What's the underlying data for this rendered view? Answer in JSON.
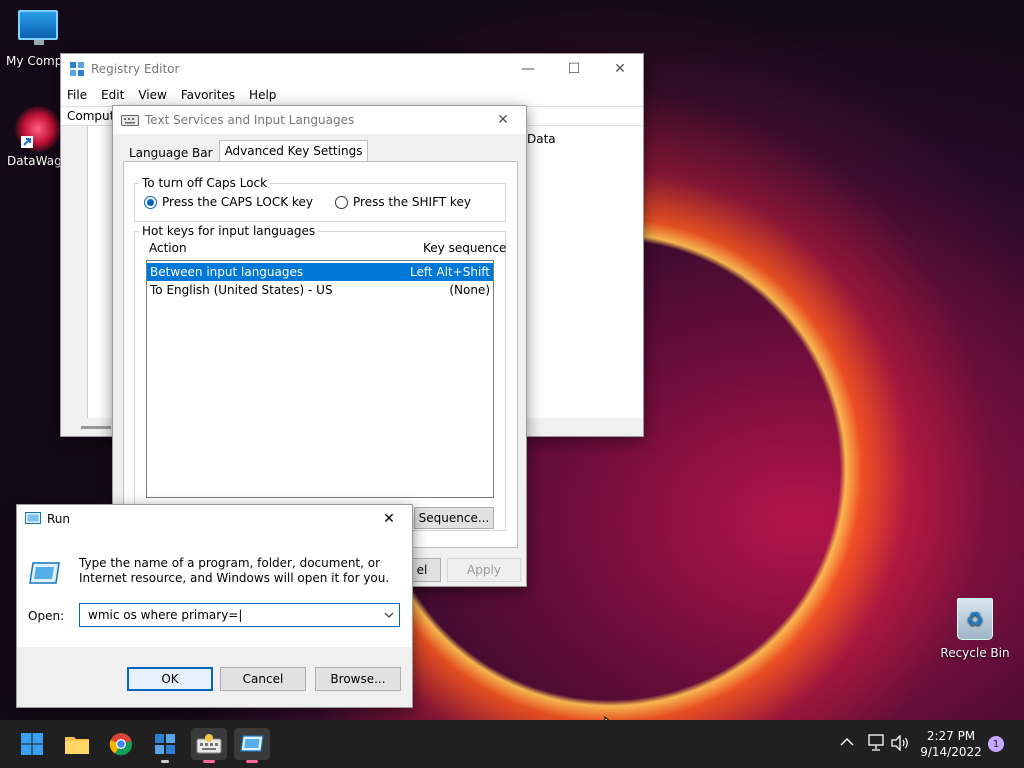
{
  "desktop": {
    "icons": [
      {
        "label": "My Compu"
      },
      {
        "label": "DataWago"
      },
      {
        "label": "Recycle Bin"
      }
    ]
  },
  "registry": {
    "title": "Registry Editor",
    "menu": [
      "File",
      "Edit",
      "View",
      "Favorites",
      "Help"
    ],
    "address": "Comput",
    "column_data": "Data"
  },
  "tsil": {
    "title": "Text Services and Input Languages",
    "tabs": [
      "Language Bar",
      "Advanced Key Settings"
    ],
    "caps_group": "To turn off Caps Lock",
    "radio_caps": "Press the CAPS LOCK key",
    "radio_shift": "Press the SHIFT key",
    "hotkeys_group": "Hot keys for input languages",
    "col_action": "Action",
    "col_keyseq": "Key sequence",
    "rows": [
      {
        "action": "Between input languages",
        "seq": "Left Alt+Shift"
      },
      {
        "action": "To English (United States) - US",
        "seq": "(None)"
      }
    ],
    "change_seq": "Sequence...",
    "cancel_fragment": "el",
    "apply": "Apply"
  },
  "run": {
    "title": "Run",
    "description": "Type the name of a program, folder, document, or Internet resource, and Windows will open it for you.",
    "open_label": "Open:",
    "open_value": "wmic os where primary=|",
    "ok": "OK",
    "cancel": "Cancel",
    "browse": "Browse..."
  },
  "taskbar": {
    "time": "2:27 PM",
    "date": "9/14/2022",
    "notification_count": "1"
  },
  "colors": {
    "accent": "#0067c0",
    "selection": "#0078d7",
    "taskbar": "#202020"
  }
}
